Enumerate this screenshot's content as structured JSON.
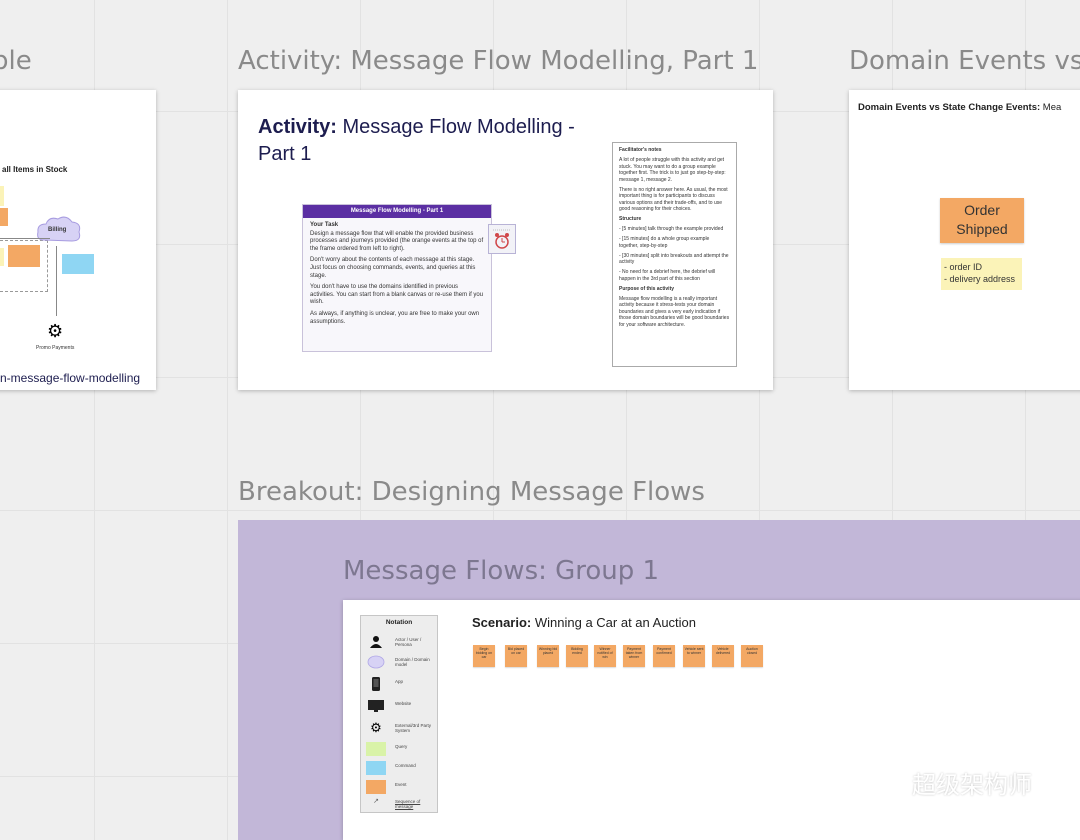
{
  "board": {
    "frame_titles": {
      "left": "ple",
      "activity": "Activity: Message Flow Modelling, Part 1",
      "domain": "Domain Events vs S",
      "breakout": "Breakout: Designing Message Flows",
      "group1": "Message Flows: Group 1"
    }
  },
  "left_frame": {
    "heading": "all Items in Stock",
    "billing": "Billing",
    "gear_caption": "Promo Payments",
    "link": "n-message-flow-modelling"
  },
  "activity": {
    "heading_bold": "Activity:",
    "heading_rest": " Message Flow Modelling - Part 1",
    "task_card": {
      "title": "Message Flow Modelling - Part 1",
      "your_task": "Your Task",
      "p1": "Design a message flow that will enable the provided business processes and journeys provided (the orange events at the top of the frame ordered from left to right).",
      "p2": "Don't worry about the contents of each message at this stage. Just focus on choosing commands, events, and queries at this stage.",
      "p3": "You don't have to use the domains identified in previous activities. You can start from a blank canvas or re-use them if you wish.",
      "p4": "As always, if anything is unclear, you are free to make your own assumptions."
    },
    "notes": {
      "title": "Facilitator's notes",
      "n1": "A lot of people struggle with this activity and get stuck. You may want to do a group example together first. The trick is to just go step-by-step: message 1, message 2.",
      "n2": "There is no right answer here. As usual, the most important thing is for participants to discuss various options and their trade-offs, and to use good reasoning for their choices.",
      "structure": "Structure",
      "s1": "- [5 minutes] talk through the example provided",
      "s2": "- [15 minutes] do a whole group example together, step-by-step",
      "s3": "- [30 minutes] split into breakouts and attempt the activity",
      "s4": "- No need for a debrief here, the debrief will happen in the 3rd part of this section",
      "purpose": "Purpose of this activity",
      "p1": "Message flow modelling is a really important activity because it stress-tests your domain boundaries and gives a very early indication if those domain boundaries will be good boundaries for your software architecture."
    }
  },
  "domain": {
    "heading_bold": "Domain Events vs State Change Events:",
    "heading_rest": " Mea",
    "event_note": "Order Shipped",
    "detail_1": "- order ID",
    "detail_2": "- delivery address"
  },
  "group1": {
    "scenario_bold": "Scenario:",
    "scenario_rest": " Winning a Car at an Auction",
    "notation": {
      "title": "Notation",
      "items": [
        "Actor / User / Persona",
        "Domain / Domain model",
        "App",
        "Website",
        "External/3rd Party System",
        "Query",
        "Command",
        "Event",
        "Sequence of message"
      ]
    },
    "events": [
      "Begin bidding on car",
      "Bid placed on car",
      "Winning bid placed",
      "Bidding ended",
      "Winner notified of win",
      "Payment taken from winner",
      "Payment confirmed",
      "Vehicle sent to winner",
      "Vehicle delivered",
      "Auction closed"
    ]
  },
  "watermark": "超级架构师",
  "colors": {
    "event": "#f3a864",
    "command": "#8fd6f3",
    "query": "#d9f3a8",
    "domain": "#d7d2f5",
    "breakout_bg": "#c2b7d8",
    "header_purple": "#5b2fa3"
  }
}
